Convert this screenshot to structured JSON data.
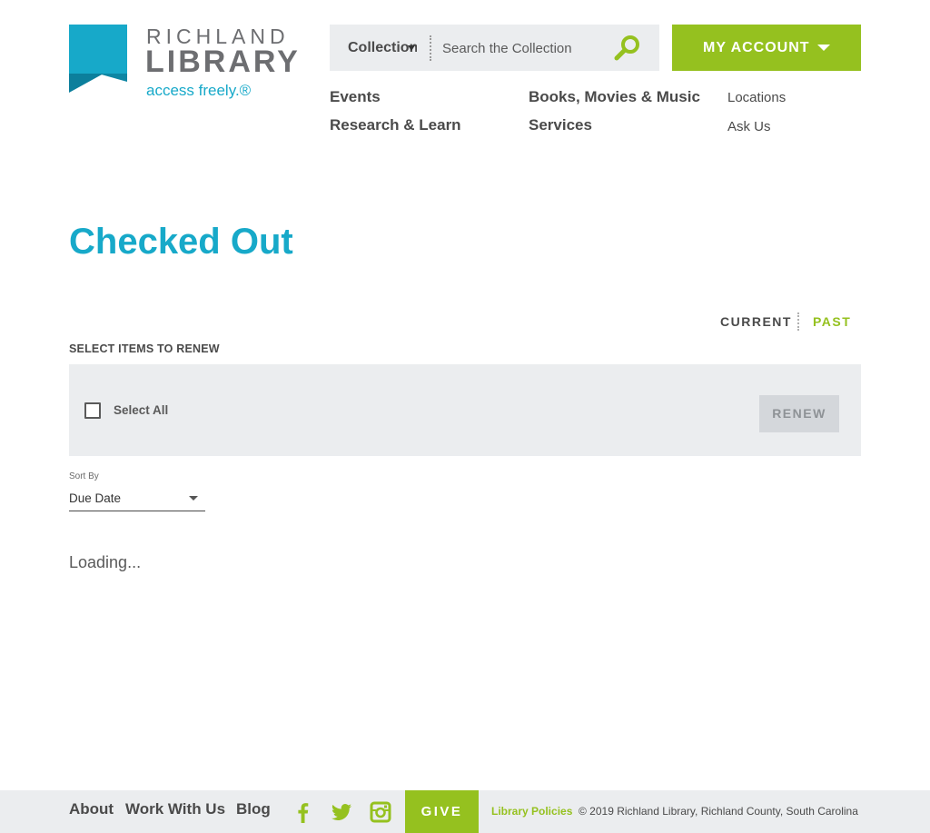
{
  "logo": {
    "word1": "RICHLAND",
    "word2": "LIBRARY",
    "tagline": "access freely.®",
    "brand_color": "#17a9c9"
  },
  "search": {
    "category": "Collection",
    "placeholder": "Search the Collection",
    "icon": "magnifier-icon"
  },
  "account": {
    "label": "MY ACCOUNT",
    "color": "#95c11f"
  },
  "nav": {
    "events": "Events",
    "research": "Research & Learn",
    "books": "Books, Movies & Music",
    "services": "Services",
    "locations": "Locations",
    "ask": "Ask Us"
  },
  "page": {
    "title": "Checked Out"
  },
  "tabs": {
    "current": "CURRENT",
    "past": "PAST"
  },
  "renew": {
    "section_label": "SELECT ITEMS TO RENEW",
    "select_all": "Select All",
    "button": "RENEW"
  },
  "sort": {
    "label": "Sort By",
    "value": "Due Date"
  },
  "status": {
    "loading": "Loading..."
  },
  "footer": {
    "about": "About",
    "work": "Work With Us",
    "blog": "Blog",
    "social_icons": [
      "facebook-icon",
      "twitter-icon",
      "instagram-icon"
    ],
    "give": "GIVE",
    "policies": "Library Policies",
    "copyright": "© 2019 Richland Library, Richland County, South Carolina"
  }
}
